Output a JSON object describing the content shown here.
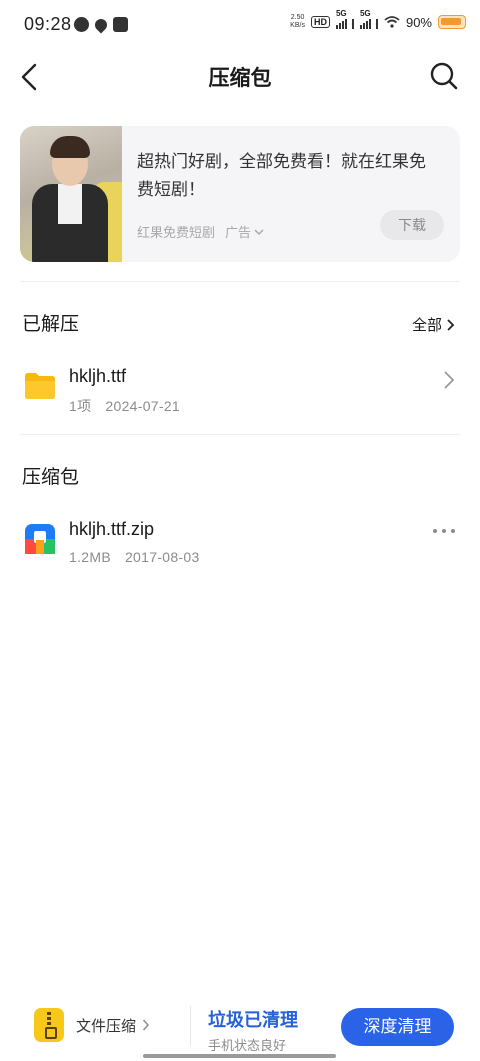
{
  "status_bar": {
    "time": "09:28",
    "speed_value": "2.50",
    "speed_unit": "KB/s",
    "hd_label": "HD",
    "sim1_label": "5G",
    "sim2_label": "5G",
    "battery_percent": "90%",
    "battery_level": 0.9
  },
  "header": {
    "title": "压缩包",
    "back_icon": "chevron-left-icon",
    "search_icon": "search-icon"
  },
  "ad": {
    "text": "超热门好剧，全部免费看！就在红果免费短剧！",
    "source": "红果免费短剧",
    "label": "广告",
    "download_label": "下载"
  },
  "unzipped": {
    "title": "已解压",
    "all_label": "全部",
    "items": [
      {
        "name": "hkljh.ttf",
        "count": "1项",
        "date": "2024-07-21",
        "icon": "folder-icon"
      }
    ]
  },
  "archives": {
    "title": "压缩包",
    "items": [
      {
        "name": "hkljh.ttf.zip",
        "size": "1.2MB",
        "date": "2017-08-03",
        "icon": "zip-file-icon"
      }
    ]
  },
  "bottom_bar": {
    "zip_tool_label": "文件压缩",
    "clean_title": "垃圾已清理",
    "clean_subtitle": "手机状态良好",
    "deep_clean_label": "深度清理"
  },
  "colors": {
    "accent": "#2a62e8",
    "clean_text": "#2561d9",
    "folder": "#fcc419",
    "zip_icon_bg": "#f7c71a"
  }
}
